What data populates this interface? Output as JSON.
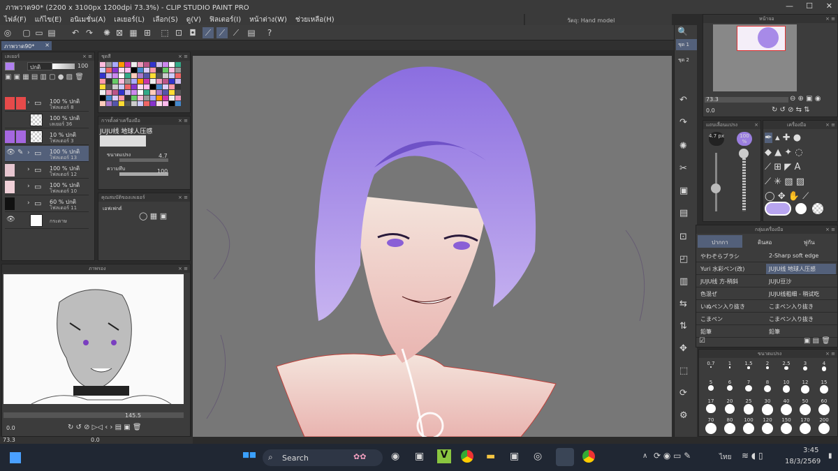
{
  "window": {
    "title": "ภาพวาด90* (2200 x 3100px 1200dpi 73.3%) - CLIP STUDIO PAINT PRO"
  },
  "menu": [
    "ไฟล์(F)",
    "แก้ไข(E)",
    "อนิเมชั่น(A)",
    "เลเยอร์(L)",
    "เลือก(S)",
    "ดู(V)",
    "ฟิลเตอร์(I)",
    "หน้าต่าง(W)",
    "ช่วยเหลือ(H)"
  ],
  "tab": {
    "label": "ภาพวาด90*"
  },
  "hand_model": {
    "label": "วัตถุ: Hand model"
  },
  "layer_panel": {
    "title": "เลเยอร์",
    "blend": "ปกติ",
    "opacity": "100",
    "layers": [
      {
        "l1": "100 % ปกติ",
        "l2": "โฟลเดอร์ 8"
      },
      {
        "l1": "100 % ปกติ",
        "l2": "เลเยอร์ 36"
      },
      {
        "l1": "10 % ปกติ",
        "l2": "โฟลเดอร์ 3"
      },
      {
        "l1": "100 % ปกติ",
        "l2": "โฟลเดอร์ 13"
      },
      {
        "l1": "100 % ปกติ",
        "l2": "โฟลเดอร์ 12"
      },
      {
        "l1": "100 % ปกติ",
        "l2": "โฟลเดอร์ 10"
      },
      {
        "l1": "60 % ปกติ",
        "l2": "โฟลเดอร์ 11"
      },
      {
        "l1": "",
        "l2": "กระดาษ"
      }
    ]
  },
  "palette_panel": {
    "title": "ชุดสี"
  },
  "tool_property": {
    "title": "การตั้งค่าเครื่องมือ",
    "brush": "JUJU线 地球人压感",
    "size_label": "ขนาดแปรง",
    "size_value": "4.7",
    "density_label": "ความทึบ",
    "density_value": "100"
  },
  "layer_property": {
    "title": "คุณสมบัติของเลเยอร์",
    "effect": "เอฟเฟกต์"
  },
  "navigator_left": {
    "title": "ภาพรอง",
    "zoom": "145.5",
    "angle": "0.0"
  },
  "status_left": {
    "zoom": "73.3",
    "angle": "0.0"
  },
  "navigator": {
    "title": "หน้าจอ",
    "zoom": "73.3",
    "angle": "0.0",
    "sets": [
      "ชุด 1",
      "ชุด 2"
    ]
  },
  "brush_size_panel": {
    "title": "แถบเลื่อนแปรง",
    "size": "4.7 px",
    "opacity": "100 %"
  },
  "tool_panel": {
    "title": "เครื่องมือ"
  },
  "sub_tool": {
    "title": "กลุ่มเครื่องมือ",
    "tabs": [
      "ปากกา",
      "ดินสอ",
      "พู่กัน"
    ],
    "items_left": [
      "やわぞらブラシ",
      "Yuri 水彩ペン(改)",
      "JUJU线 方-稍斜",
      "色混ぜ",
      "いぬペン入り抜き",
      "こまペン",
      "鉛筆"
    ],
    "items_right": [
      "2-Sharp soft edge",
      "JUJU线 地球人压感",
      "JUJU豆沙",
      "JUJU线粗细 - 稍试吃",
      "こまペン入り抜き",
      "こまペン入り抜き",
      "鉛筆"
    ]
  },
  "brush_size_grid": {
    "title": "ขนาดแปรง",
    "values": [
      "0.7",
      "1",
      "1.5",
      "2",
      "2.5",
      "3",
      "4",
      "5",
      "6",
      "7",
      "8",
      "10",
      "12",
      "15",
      "17",
      "20",
      "25",
      "30",
      "40",
      "50",
      "60",
      "70",
      "80",
      "100",
      "120",
      "150",
      "170",
      "200"
    ]
  },
  "taskbar": {
    "search": "Search",
    "lang": "ไทย",
    "time": "3:45",
    "date": "18/3/2569"
  },
  "colors": {
    "accent": "#9b7fe0",
    "hair": "#a78ae8"
  }
}
